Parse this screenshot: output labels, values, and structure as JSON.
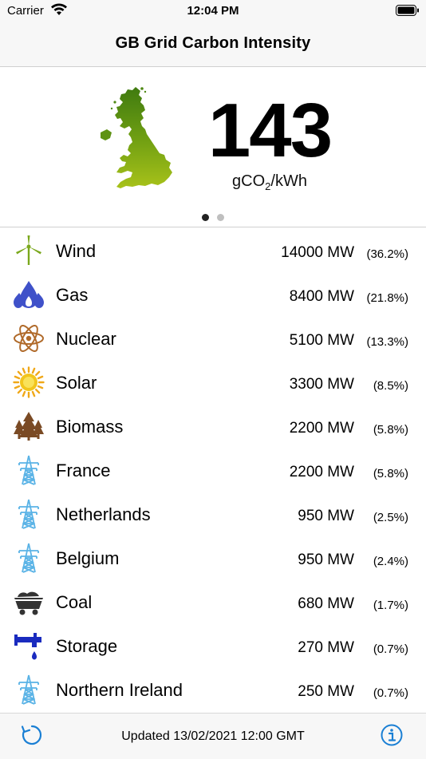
{
  "status_bar": {
    "carrier": "Carrier",
    "time": "12:04 PM"
  },
  "nav": {
    "title": "GB Grid Carbon Intensity"
  },
  "hero": {
    "value": "143",
    "unit_prefix": "gCO",
    "unit_sub": "2",
    "unit_suffix": "/kWh",
    "pages": 2,
    "current_page": 1
  },
  "sources": [
    {
      "name": "Wind",
      "mw": "14000 MW",
      "pct": "(36.2%)",
      "icon": "wind-turbine-icon",
      "color": "#7aa81c"
    },
    {
      "name": "Gas",
      "mw": "8400 MW",
      "pct": "(21.8%)",
      "icon": "gas-flame-icon",
      "color": "#3f51c9"
    },
    {
      "name": "Nuclear",
      "mw": "5100 MW",
      "pct": "(13.3%)",
      "icon": "atom-icon",
      "color": "#b06a2a"
    },
    {
      "name": "Solar",
      "mw": "3300 MW",
      "pct": "(8.5%)",
      "icon": "sun-icon",
      "color": "#f2c51c"
    },
    {
      "name": "Biomass",
      "mw": "2200 MW",
      "pct": "(5.8%)",
      "icon": "trees-icon",
      "color": "#7a4a24"
    },
    {
      "name": "France",
      "mw": "2200 MW",
      "pct": "(5.8%)",
      "icon": "pylon-icon",
      "color": "#5ab3e6"
    },
    {
      "name": "Netherlands",
      "mw": "950 MW",
      "pct": "(2.5%)",
      "icon": "pylon-icon",
      "color": "#5ab3e6"
    },
    {
      "name": "Belgium",
      "mw": "950 MW",
      "pct": "(2.4%)",
      "icon": "pylon-icon",
      "color": "#5ab3e6"
    },
    {
      "name": "Coal",
      "mw": "680 MW",
      "pct": "(1.7%)",
      "icon": "coal-cart-icon",
      "color": "#333333"
    },
    {
      "name": "Storage",
      "mw": "270 MW",
      "pct": "(0.7%)",
      "icon": "water-tap-icon",
      "color": "#1a2bbf"
    },
    {
      "name": "Northern Ireland",
      "mw": "250 MW",
      "pct": "(0.7%)",
      "icon": "pylon-icon",
      "color": "#5ab3e6"
    }
  ],
  "toolbar": {
    "updated": "Updated 13/02/2021 12:00 GMT",
    "refresh_icon": "refresh-icon",
    "info_icon": "info-icon",
    "accent": "#1a7fd4"
  }
}
